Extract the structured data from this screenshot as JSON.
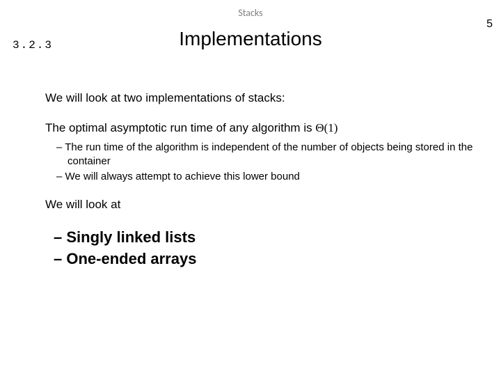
{
  "header": {
    "label": "Stacks"
  },
  "page_number": "5",
  "section_number": "3.2.3",
  "title": "Implementations",
  "body": {
    "intro": "We will look at two implementations of stacks:",
    "optimal_prefix": "The optimal asymptotic run time of any algorithm is ",
    "optimal_theta": "Θ(1)",
    "sub_points": [
      "The run time of the algorithm is independent of the number of objects being stored in the container",
      "We will always attempt to achieve this lower bound"
    ],
    "look_at": "We will look at",
    "bold_points": [
      "Singly linked lists",
      "One-ended arrays"
    ]
  }
}
